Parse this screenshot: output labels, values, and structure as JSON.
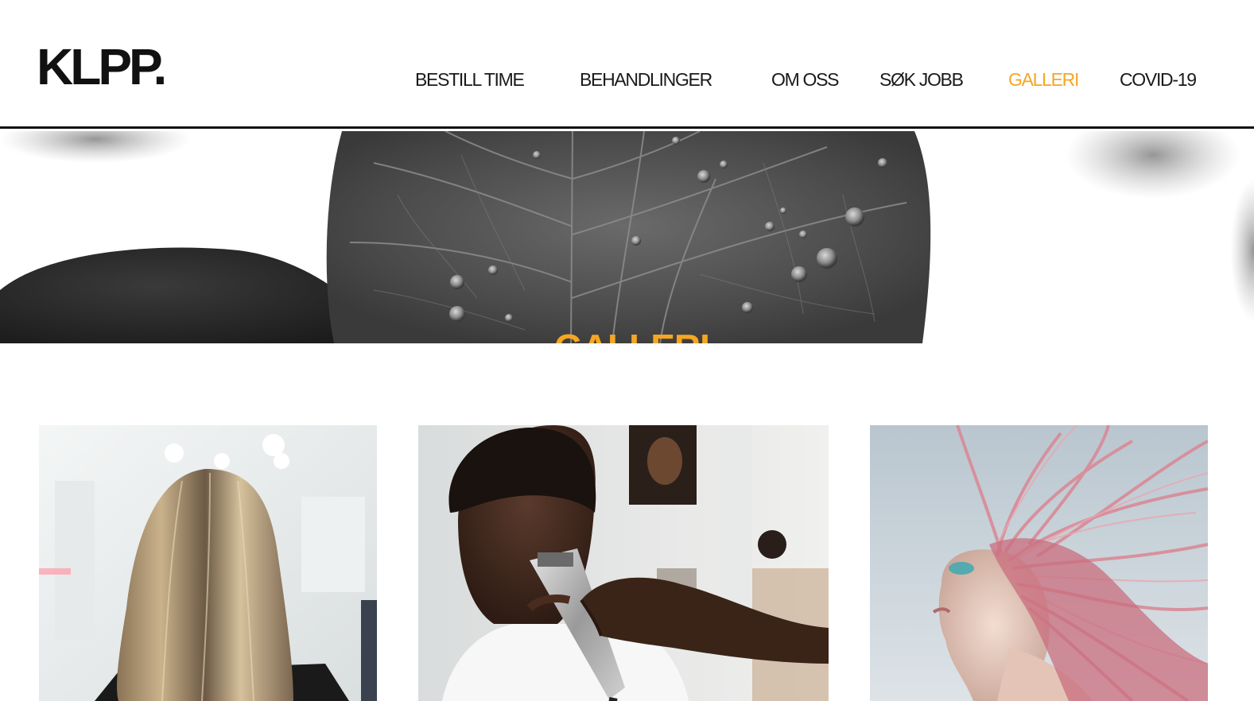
{
  "brand": {
    "logo_text": "KLPP."
  },
  "nav": {
    "items": [
      {
        "label": "BESTILL TIME",
        "active": false
      },
      {
        "label": "BEHANDLINGER",
        "active": false
      },
      {
        "label": "OM OSS",
        "active": false
      },
      {
        "label": "SØK JOBB",
        "active": false
      },
      {
        "label": "GALLERI",
        "active": true
      },
      {
        "label": "COVID-19",
        "active": false
      }
    ]
  },
  "hero": {
    "title": "GALLERI",
    "image": "leaf-with-water-drops-photo"
  },
  "gallery": {
    "images": [
      {
        "subject": "blonde-hair-back-view-photo"
      },
      {
        "subject": "barber-clipper-haircut-photo"
      },
      {
        "subject": "pink-hair-woman-profile-photo"
      }
    ]
  },
  "colors": {
    "accent": "#f5a623",
    "text": "#1a1a1a",
    "header_border": "#111111",
    "background": "#ffffff"
  }
}
